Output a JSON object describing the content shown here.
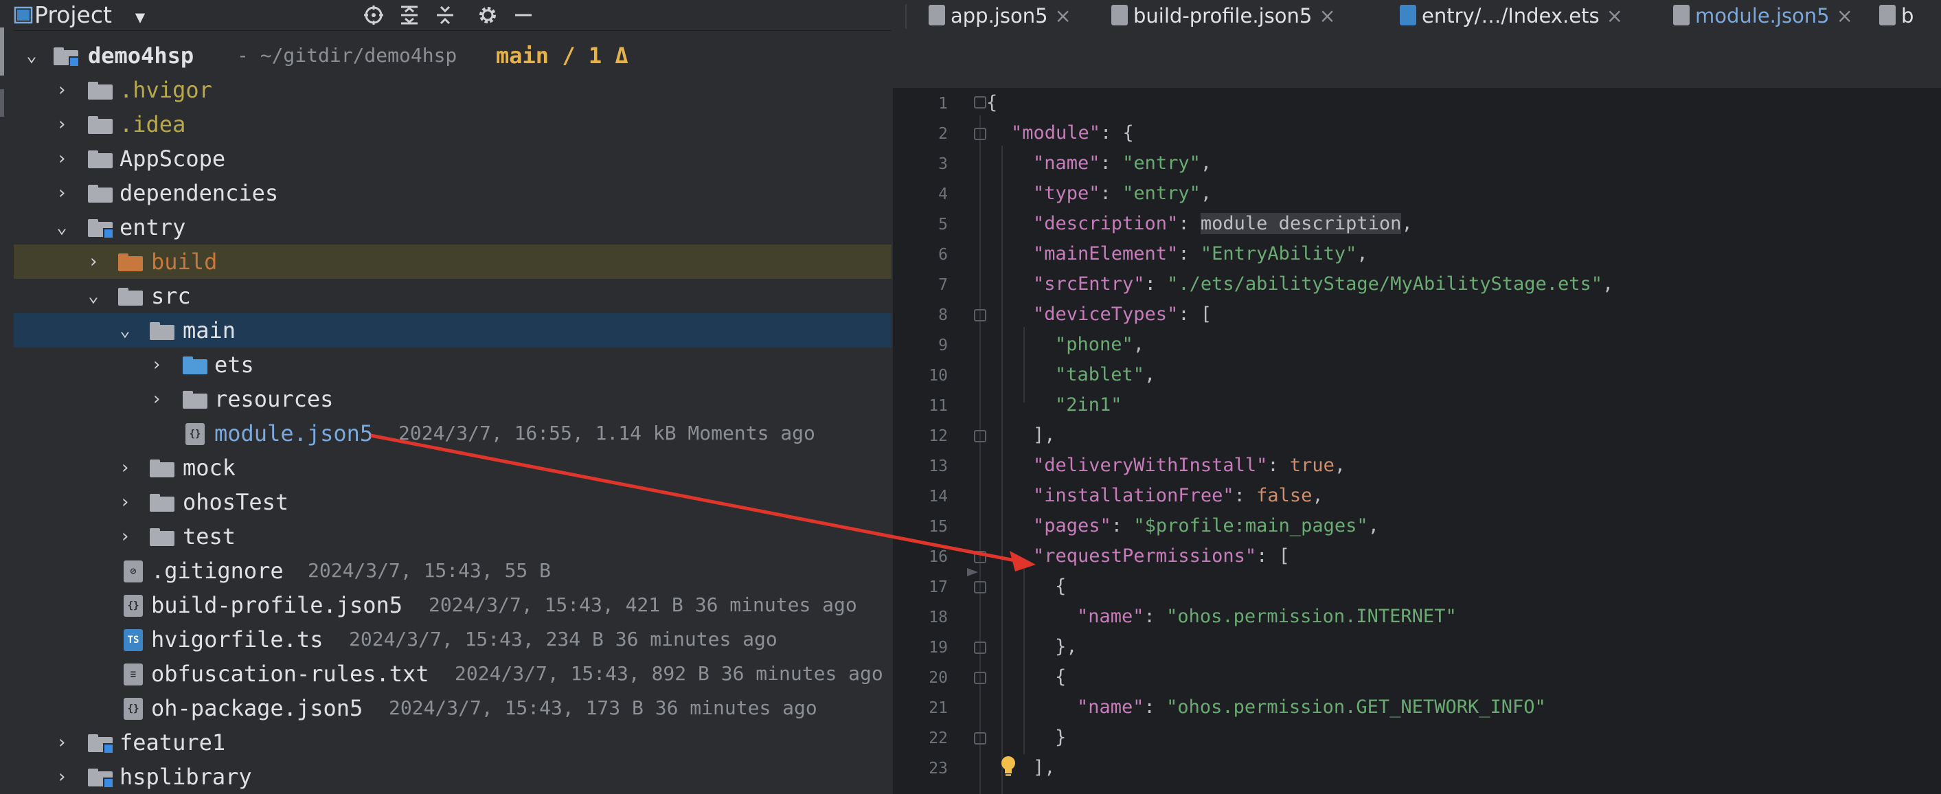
{
  "project_panel": {
    "title": "Project",
    "tree": [
      {
        "name": "demo4hsp",
        "path": "- ~/gitdir/demo4hsp",
        "git": "main / 1 Δ"
      },
      {
        "name": ".hvigor"
      },
      {
        "name": ".idea"
      },
      {
        "name": "AppScope"
      },
      {
        "name": "dependencies"
      },
      {
        "name": "entry"
      },
      {
        "name": "build"
      },
      {
        "name": "src"
      },
      {
        "name": "main"
      },
      {
        "name": "ets"
      },
      {
        "name": "resources"
      },
      {
        "name": "module.json5",
        "meta": "2024/3/7, 16:55, 1.14 kB Moments ago"
      },
      {
        "name": "mock"
      },
      {
        "name": "ohosTest"
      },
      {
        "name": "test"
      },
      {
        "name": ".gitignore",
        "meta": "2024/3/7, 15:43, 55 B"
      },
      {
        "name": "build-profile.json5",
        "meta": "2024/3/7, 15:43, 421 B 36 minutes ago"
      },
      {
        "name": "hvigorfile.ts",
        "meta": "2024/3/7, 15:43, 234 B 36 minutes ago"
      },
      {
        "name": "obfuscation-rules.txt",
        "meta": "2024/3/7, 15:43, 892 B 36 minutes ago"
      },
      {
        "name": "oh-package.json5",
        "meta": "2024/3/7, 15:43, 173 B 36 minutes ago"
      },
      {
        "name": "feature1"
      },
      {
        "name": "hsplibrary"
      }
    ]
  },
  "tabs": [
    {
      "label": "app.json5"
    },
    {
      "label": "build-profile.json5"
    },
    {
      "label": "entry/…/Index.ets"
    },
    {
      "label": "module.json5",
      "active": true
    },
    {
      "label": "b"
    }
  ],
  "editor": {
    "lines": [
      {
        "no": "1"
      },
      {
        "no": "2"
      },
      {
        "no": "3"
      },
      {
        "no": "4"
      },
      {
        "no": "5"
      },
      {
        "no": "6"
      },
      {
        "no": "7"
      },
      {
        "no": "8"
      },
      {
        "no": "9"
      },
      {
        "no": "10"
      },
      {
        "no": "11"
      },
      {
        "no": "12"
      },
      {
        "no": "13"
      },
      {
        "no": "14"
      },
      {
        "no": "15"
      },
      {
        "no": "16"
      },
      {
        "no": "17"
      },
      {
        "no": "18"
      },
      {
        "no": "19"
      },
      {
        "no": "20"
      },
      {
        "no": "21"
      },
      {
        "no": "22"
      },
      {
        "no": "23"
      }
    ],
    "tokens": {
      "module_key": "\"module\"",
      "name_key": "\"name\"",
      "name_val": "\"entry\"",
      "type_key": "\"type\"",
      "type_val": "\"entry\"",
      "desc_key": "\"description\"",
      "desc_val": "module description",
      "main_key": "\"mainElement\"",
      "main_val": "\"EntryAbility\"",
      "src_key": "\"srcEntry\"",
      "src_val": "\"./ets/abilityStage/MyAbilityStage.ets\"",
      "dev_key": "\"deviceTypes\"",
      "dev1": "\"phone\"",
      "dev2": "\"tablet\"",
      "dev3": "\"2in1\"",
      "dwi_key": "\"deliveryWithInstall\"",
      "dwi_val": "true",
      "inst_key": "\"installationFree\"",
      "inst_val": "false",
      "pages_key": "\"pages\"",
      "pages_val": "\"$profile:main_pages\"",
      "req_key": "\"requestPermissions\"",
      "perm_name_key": "\"name\"",
      "perm1": "\"ohos.permission.INTERNET\"",
      "perm2": "\"ohos.permission.GET_NETWORK_INFO\""
    }
  },
  "colors": {
    "annotation_arrow": "#e0352b",
    "selected_row": "#1f3a55",
    "excluded_row": "#43412c",
    "active_tab_underline": "#3574f0"
  }
}
